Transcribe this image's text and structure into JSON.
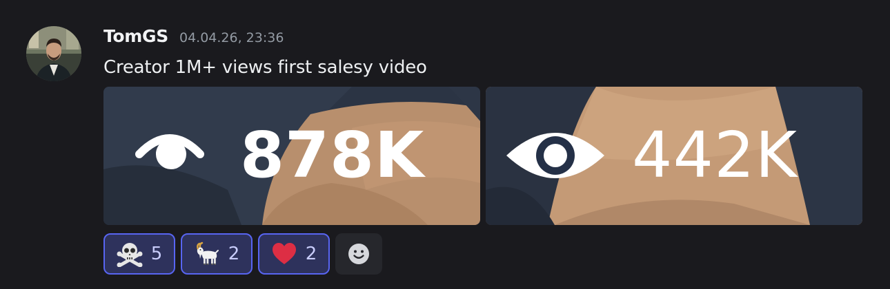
{
  "message": {
    "username": "TomGS",
    "timestamp": "04.04.26, 23:36",
    "text": "Creator 1M+ views first salesy video"
  },
  "attachments": [
    {
      "views": "878K",
      "icon": "eye-icon"
    },
    {
      "views": "442K",
      "icon": "eye-icon"
    }
  ],
  "reactions": [
    {
      "emoji": "skull-and-crossbones",
      "count": "5"
    },
    {
      "emoji": "goat",
      "count": "2"
    },
    {
      "emoji": "red-heart",
      "count": "2"
    }
  ],
  "add_reaction": {
    "icon": "smiley-add-reaction-icon"
  },
  "colors": {
    "background": "#1a1a1e",
    "reaction_border": "#5865f2",
    "reaction_bg": "#2e325c",
    "timestamp": "#949ba4"
  }
}
